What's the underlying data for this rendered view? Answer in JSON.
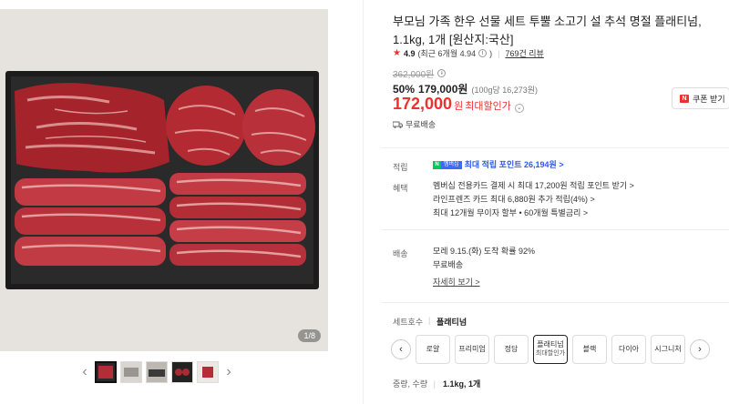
{
  "gallery": {
    "counter": "1/8",
    "prev_arrow": "‹",
    "next_arrow": "›"
  },
  "product": {
    "title": "부모님 가족 한우 선물 세트 투뿔 소고기 설 추석 명절 플래티넘, 1.1kg, 1개 [원산지:국산]",
    "rating": {
      "score": "4.9",
      "recent": "(최근 6개월 4.94",
      "recent_close": ")",
      "reviews": "769건 리뷰"
    },
    "original_price": "362,000원",
    "discount_rate": "50%",
    "discount_price": "179,000원",
    "unit_price": "(100g당 16,273원)",
    "best_price": "172,000",
    "best_price_unit": "원",
    "best_price_label": "최대할인가",
    "coupon_label": "쿠폰 받기",
    "free_delivery": "무료배송"
  },
  "benefits": {
    "points_label": "적립",
    "membership_badge": "멤버십",
    "points_text": "최대 적립 포인트 26,194원 >",
    "perks_label": "혜택",
    "perks": [
      "멤버십 전용카드 결제 시 최대 17,200원 적립 포인트 받기 >",
      "라인프렌즈 카드 최대 6,880원 추가 적립(4%) >",
      "최대 12개월 무이자 할부 • 60개월 특별금리 >"
    ]
  },
  "shipping": {
    "label": "배송",
    "eta": "모레 9.15.(화) 도착 확률 92%",
    "fee": "무료배송",
    "more": "자세히 보기 >"
  },
  "set_option": {
    "label": "세트호수",
    "separator": "|",
    "selected": "플래티넘",
    "prev": "‹",
    "next": "›",
    "options": [
      {
        "label": "로얄",
        "sub": ""
      },
      {
        "label": "프리미엄",
        "sub": ""
      },
      {
        "label": "정담",
        "sub": ""
      },
      {
        "label": "플래티넘",
        "sub": "최대할인가"
      },
      {
        "label": "블랙",
        "sub": ""
      },
      {
        "label": "다이아",
        "sub": ""
      },
      {
        "label": "시그니처",
        "sub": ""
      }
    ]
  },
  "quantity": {
    "label": "중량, 수량",
    "separator": "|",
    "value": "1.1kg, 1개"
  },
  "colors": {
    "accent_red": "#f0302d",
    "point_blue": "#2c5be6",
    "naver_green": "#03c75a"
  }
}
